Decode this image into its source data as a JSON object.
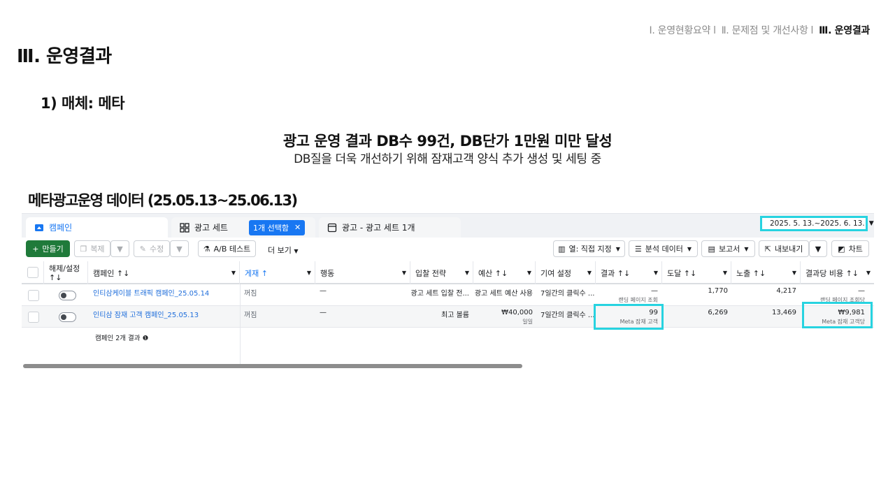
{
  "nav": {
    "item1": "Ⅰ. 운영현황요약",
    "item2": "Ⅱ. 문제점 및 개선사항",
    "item3": "Ⅲ. 운영결과",
    "separator": "l"
  },
  "section_title": "Ⅲ. 운영결과",
  "media_title": "1) 매체: 메타",
  "headline": "광고 운영 결과 DB수 99건, DB단가 1만원 미만 달성",
  "subline": "DB질을 더욱 개선하기 위해 잠재고객 양식 추가 생성 및 세팅 중",
  "data_title": "메타광고운영 데이터 (25.05.13~25.06.13)",
  "ads_manager": {
    "tabs": {
      "campaign": "캠페인",
      "adset": "광고 세트",
      "selected_chip": "1개 선택함",
      "ad": "광고 - 광고 세트 1개"
    },
    "date_range": "2025. 5. 13.~2025. 6. 13.",
    "toolbar": {
      "create": "만들기",
      "duplicate": "복제",
      "edit": "수정",
      "ab_test": "A/B 테스트",
      "more": "더 보기",
      "columns": "열: 직접 지정",
      "breakdown": "분석 데이터",
      "reports": "보고서",
      "export": "내보내기",
      "chart": "차트"
    },
    "columns": {
      "onoff": "해제/설정 ↑↓",
      "campaign": "캠페인 ↑↓",
      "delivery": "게재 ↑",
      "actions": "행동",
      "bid_strategy": "입찰 전략",
      "budget": "예산 ↑↓",
      "attribution": "기여 설정",
      "results": "결과 ↑↓",
      "reach": "도달 ↑↓",
      "impressions": "노출 ↑↓",
      "cost_per_result": "결과당 비용 ↑↓"
    },
    "rows": [
      {
        "campaign": "인티삼케이블 트래픽 캠페인_25.05.14",
        "delivery": "꺼짐",
        "actions": "—",
        "bid_strategy": "광고 세트 입찰 전...",
        "budget": "광고 세트 예산 사용",
        "budget_sub": "",
        "attribution": "7일간의 클릭수 ...",
        "results": "—",
        "results_sub": "랜딩 페이지 조회",
        "reach": "1,770",
        "impressions": "4,217",
        "cost": "—",
        "cost_sub": "랜딩 페이지 조회당"
      },
      {
        "campaign": "인티삼 잠재 고객 캠페인_25.05.13",
        "delivery": "꺼짐",
        "actions": "—",
        "bid_strategy": "최고 볼륨",
        "budget": "₩40,000",
        "budget_sub": "일일",
        "attribution": "7일간의 클릭수 ...",
        "results": "99",
        "results_sub": "Meta 잠재 고객",
        "reach": "6,269",
        "impressions": "13,469",
        "cost": "₩9,981",
        "cost_sub": "Meta 잠재 고객당"
      }
    ],
    "summary": "캠페인 2개 결과",
    "colors": {
      "highlight": "#27d3e0",
      "create_button": "#1f7a3a",
      "link": "#216fdb"
    }
  }
}
